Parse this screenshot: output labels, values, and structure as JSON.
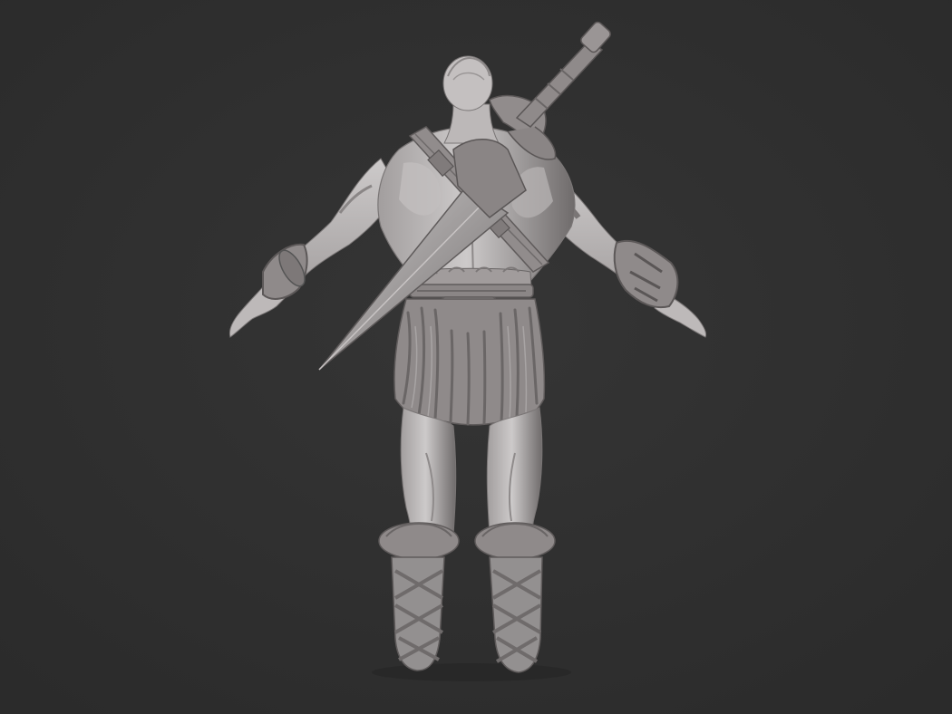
{
  "viewport": {
    "background_color": "#2f2f2f",
    "subject": "sculpt-render"
  },
  "colors": {
    "clay_light": "#cdcaca",
    "clay_mid": "#a29e9e",
    "clay_dark": "#6f6b6b",
    "clay_shadow": "#4e4b4b",
    "fur": "#8a8585",
    "blade": "#9d9999"
  },
  "model": {
    "name": "barbarian-warrior-back-view",
    "pose": "a-pose",
    "material": "grey-clay"
  }
}
